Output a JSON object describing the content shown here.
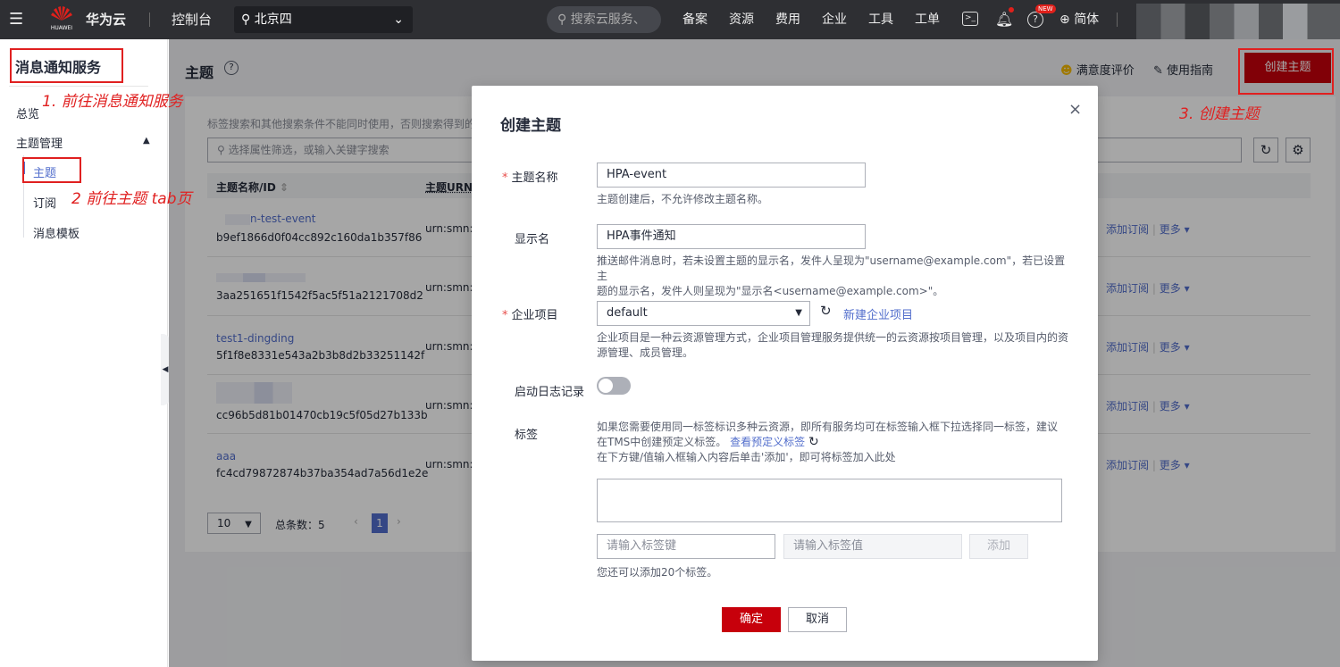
{
  "topbar": {
    "brand": "华为云",
    "logo_sub": "HUAWEI",
    "console": "控制台",
    "region": "北京四",
    "search_placeholder": "搜索云服务、",
    "nav": [
      "备案",
      "资源",
      "费用",
      "企业",
      "工具",
      "工单"
    ],
    "new_badge": "NEW",
    "lang": "简体"
  },
  "sidebar": {
    "title": "消息通知服务",
    "items": [
      "总览",
      "主题管理",
      "主题",
      "订阅",
      "消息模板"
    ]
  },
  "page": {
    "title": "主题",
    "satisfaction": "满意度评价",
    "guide": "使用指南",
    "create_button": "创建主题",
    "search_notice": "标签搜索和其他搜索条件不能同时使用，否则搜索得到的",
    "filter_placeholder": "选择属性筛选，或输入关键字搜索",
    "columns": [
      "主题名称/ID",
      "主题URN"
    ],
    "rows": [
      {
        "name": "n-test-event",
        "id": "b9ef1866d0f04cc892c160da1b357f86",
        "urn": "urn:smn:c"
      },
      {
        "name": "",
        "id": "3aa251651f1542f5ac5f51a2121708d2",
        "urn": "urn:smn:c"
      },
      {
        "name": "test1-dingding",
        "id": "5f1f8e8331e543a2b3b8d2b33251142f",
        "urn": "urn:smn:c"
      },
      {
        "name": "",
        "id": "cc96b5d81b01470cb19c5f05d27b133b",
        "urn": "urn:smn:c"
      },
      {
        "name": "aaa",
        "id": "fc4cd79872874b37ba354ad7a56d1e2e",
        "urn": "urn:smn:c"
      }
    ],
    "row_actions": {
      "subscribe": "添加订阅",
      "more": "更多"
    },
    "page_size": "10",
    "total": "总条数：5",
    "current_page": "1"
  },
  "annotations": {
    "a1": "1. 前往消息通知服务",
    "a2": "2 前往主题 tab页",
    "a3": "3. 创建主题"
  },
  "modal": {
    "title": "创建主题",
    "topic_name_label": "主题名称",
    "topic_name_value": "HPA-event",
    "topic_name_hint": "主题创建后，不允许修改主题名称。",
    "display_label": "显示名",
    "display_value": "HPA事件通知",
    "display_hint_1": "推送邮件消息时，若未设置主题的显示名，发件人呈现为\"username@example.com\"，若已设置主",
    "display_hint_2": "题的显示名，发件人则呈现为\"显示名<username@example.com>\"。",
    "ep_label": "企业项目",
    "ep_value": "default",
    "ep_new": "新建企业项目",
    "ep_hint_1": "企业项目是一种云资源管理方式，企业项目管理服务提供统一的云资源按项目管理，以及项目内的资",
    "ep_hint_2": "源管理、成员管理。",
    "log_label": "启动日志记录",
    "tag_label": "标签",
    "tag_hint_1": "如果您需要使用同一标签标识多种云资源，即所有服务均可在标签输入框下拉选择同一标签，建议",
    "tag_hint_2": "在TMS中创建预定义标签。",
    "tag_link": "查看预定义标签",
    "tag_hint_3": "在下方键/值输入框输入内容后单击'添加'，即可将标签加入此处",
    "tag_key_placeholder": "请输入标签键",
    "tag_value_placeholder": "请输入标签值",
    "add_button": "添加",
    "tag_remaining": "您还可以添加20个标签。",
    "confirm": "确定",
    "cancel": "取消"
  },
  "colors": {
    "accent": "#c7000b",
    "annotation": "#e02020",
    "link": "#526ecc"
  }
}
